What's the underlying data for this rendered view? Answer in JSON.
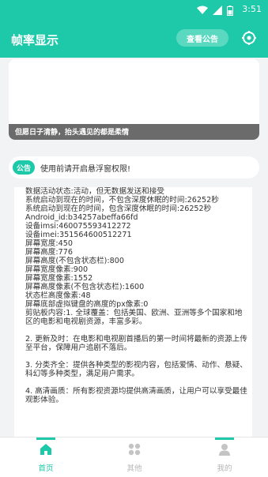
{
  "status_bar": {
    "time": "3:51"
  },
  "app_bar": {
    "title": "帧率显示",
    "notice_button": "查看公告"
  },
  "banner": {
    "caption": "但愿日子清静，抬头遇见的都是柔情"
  },
  "tip": {
    "tag": "公告",
    "text": "使用前请开启悬浮窗权限!"
  },
  "info_lines": [
    "数据活动状态:活动，但无数据发送和接受",
    "系统启动到现在的时间，不包含深度休眠的时间:26252秒",
    "系统启动到现在的时间，包含深度休眠的时间:26252秒",
    "Android_id:b34257abeffa66fd",
    "设备imsi:460075593412272",
    "设备imei:351564600512271",
    "屏幕宽度:450",
    "屏幕高度:776",
    "屏幕高度(不包含状态栏):800",
    "屏幕宽度像素:900",
    "屏幕宽度像素:1552",
    "屏幕高度像素(不包含状态栏):1600",
    "状态栏高度像素:48",
    "屏幕底部虚拟键盘的高度的px像素:0"
  ],
  "description": [
    "剪贴板内容:1. 全球覆盖：包括美国、欧洲、亚洲等多个国家和地区的电影和电视剧资源，丰富多彩。",
    "2. 更新及时：在电影和电视剧首播后的第一时间将最新的资源上传至平台，保障用户追剧不落后。",
    "3. 分类齐全：提供各种类型的影视内容，包括爱情、动作、悬疑、科幻等多种类型，满足用户需求。",
    "4. 高清画质：所有影视资源均提供高清画质，让用户可以享受最佳观影体验。"
  ],
  "tabs": [
    {
      "label": "首页",
      "icon": "home-icon",
      "active": true
    },
    {
      "label": "其他",
      "icon": "grid-icon",
      "active": false
    },
    {
      "label": "我的",
      "icon": "person-icon",
      "active": false
    }
  ],
  "colors": {
    "accent": "#1dc9a8",
    "inactive": "#b5b5b5"
  }
}
